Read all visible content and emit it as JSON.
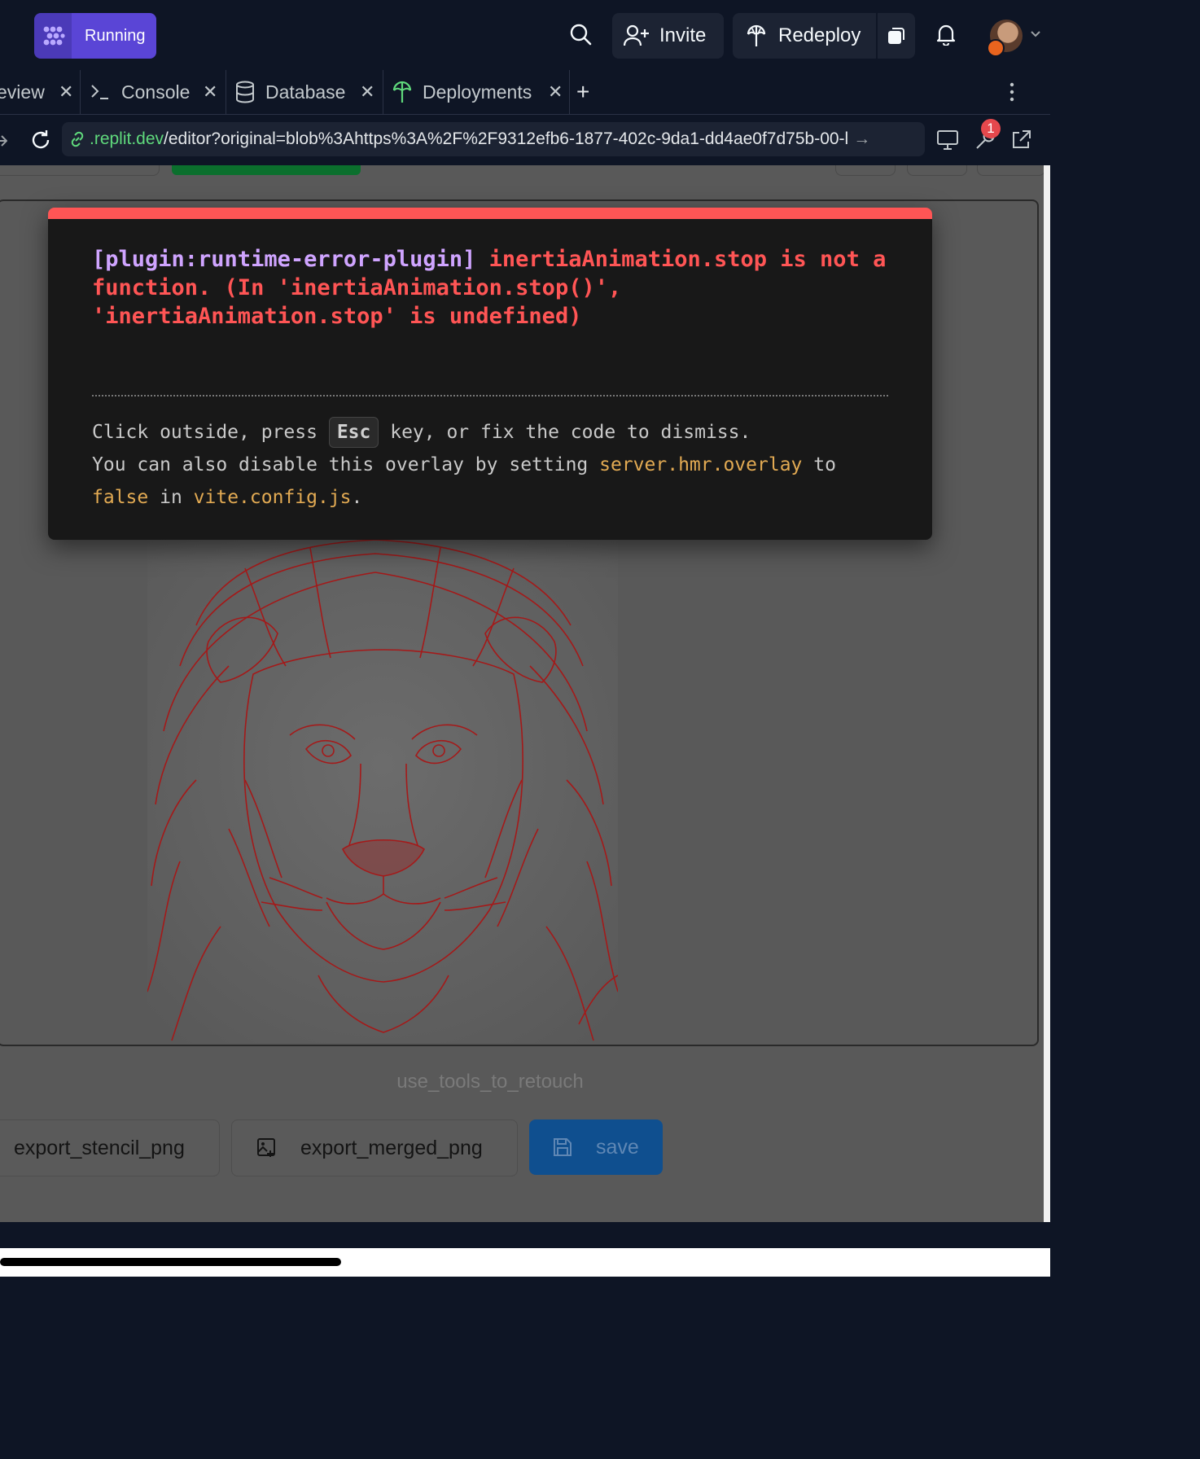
{
  "topbar": {
    "run_label": "Running",
    "invite_label": "Invite",
    "redeploy_label": "Redeploy"
  },
  "tabs": [
    {
      "label": "eview",
      "icon": "webview-icon"
    },
    {
      "label": "Console",
      "icon": "terminal-icon"
    },
    {
      "label": "Database",
      "icon": "database-icon"
    },
    {
      "label": "Deployments",
      "icon": "deployments-icon"
    }
  ],
  "address": {
    "url_host": ".replit.dev",
    "url_path": "/editor?original=blob%3Ahttps%3A%2F%2F9312efb6-1877-402c-9da1-dd4ae0f7d75b-00-l",
    "badge_count": "1"
  },
  "overlay": {
    "plugin": "[plugin:runtime-error-plugin]",
    "message": "inertiaAnimation.stop is not a function. (In 'inertiaAnimation.stop()', 'inertiaAnimation.stop' is undefined)",
    "tip1_a": "Click outside, press",
    "tip1_key": "Esc",
    "tip1_b": "key, or fix the code to dismiss.",
    "tip2_a": "You can also disable this overlay by setting",
    "tip2_code1": "server.hmr.overlay",
    "tip2_b": "to",
    "tip2_code2": "false",
    "tip2_c": "in",
    "tip2_code3": "vite.config.js",
    "tip2_d": "."
  },
  "page": {
    "hint": "use_tools_to_retouch",
    "export_stencil_label": "export_stencil_png",
    "export_merged_label": "export_merged_png",
    "save_label": "save"
  },
  "colors": {
    "accent": "#5a45d6",
    "error": "#ff5555",
    "save_button": "#0f4f8f",
    "stencil_lines": "#b01818"
  }
}
